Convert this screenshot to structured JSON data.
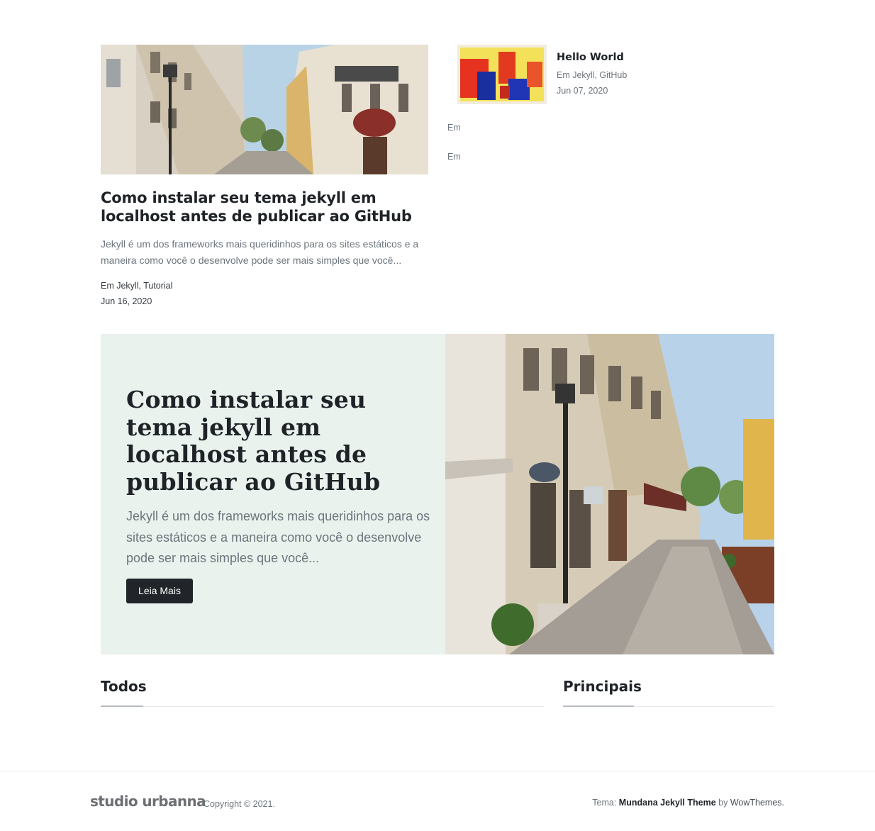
{
  "featured": {
    "title": "Como instalar seu tema jekyll em localhost antes de publicar ao GitHub",
    "excerpt": "Jekyll é um dos frameworks mais queridinhos para os sites estáticos e a maneira como você o desenvolve pode ser mais simples que você...",
    "categories": "Em Jekyll, Tutorial",
    "date": "Jun 16, 2020"
  },
  "side_posts": {
    "first": {
      "title": "Hello World",
      "categories": "Em Jekyll, GitHub",
      "date": "Jun 07, 2020"
    },
    "em_1": "Em",
    "em_2": "Em"
  },
  "jumbotron": {
    "title": "Como instalar seu tema jekyll em localhost antes de publicar ao GitHub",
    "excerpt": "Jekyll é um dos frameworks mais queridinhos para os sites estáticos e a maneira como você o desenvolve pode ser mais simples que você...",
    "button_label": "Leia Mais"
  },
  "sections": {
    "all": "Todos",
    "main": "Principais"
  },
  "footer": {
    "logo": "studio urbanna",
    "copyright": "Copyright © 2021.",
    "theme_prefix": "Tema: ",
    "theme_name": "Mundana Jekyll Theme",
    "theme_by": " by ",
    "author": "WowThemes."
  }
}
